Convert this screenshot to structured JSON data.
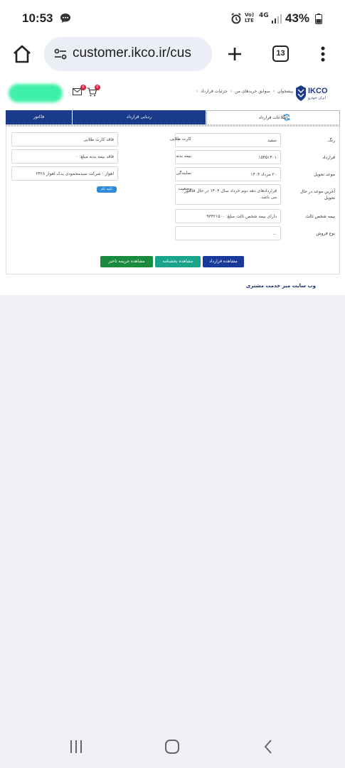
{
  "status_bar": {
    "time": "10:53",
    "lte_label": "Vo) LTE",
    "network": "4G",
    "battery": "43%"
  },
  "browser": {
    "url": "customer.ikco.ir/cus",
    "tab_count": "13"
  },
  "header": {
    "mail_badge": "0",
    "cart_badge": "0",
    "breadcrumb": [
      "پیشخوان",
      "سوابق خریدهای من",
      "جزئیات قرارداد"
    ],
    "logo_text": "IKCO",
    "logo_sub": "ایران خودرو",
    "brand_color": "#1a3a8a"
  },
  "tabs": {
    "info": "اطلاعات قرارداد",
    "tracking": "ردیابی قرارداد",
    "invoice": "فاکتور"
  },
  "form": {
    "color_label": "رنگ",
    "color_value": "سفید",
    "contract_label": "قرارداد",
    "contract_value": "۱۵۴۵۱۴۰۱",
    "delivery_label": "موعد تحویل",
    "delivery_value": "۲۰ مرداد ۱۴۰۴",
    "last_delivery_label": "آخرین موعد در حال تحویل",
    "last_delivery_value": "قراردادهای دهه دوم خرداد سال ۱۴۰۴ در حال فاکتور می باشد.",
    "third_party_label": "بیمه شخص ثالث",
    "third_party_value": "دارای بیمه شخص ثالث مبلغ: ۹۳۳۲۱۵۰۰",
    "sale_type_label": "نوع فروش",
    "sale_type_value": "...",
    "gold_card_label": "کارت طلایی",
    "gold_card_value": "فاقد کارت طلایی",
    "body_ins_label": "بیمه بدنه",
    "body_ins_value": "فاقد بیمه بدنه مبلغ: ۰",
    "agency_label": "نمایندگی",
    "agency_value": "اهواز : شرکت سیدمحمودی یدک اهواز ۲۴۲۸",
    "status_label": "وضعیت",
    "status_value": "تایید نام"
  },
  "buttons": {
    "contract": "مشاهده قرارداد",
    "invoice": "مشاهده بخشنامه",
    "penalty": "مشاهده جریمه تاخیر"
  },
  "footer": {
    "link": "وب سایت میز خدمت مشتری"
  }
}
